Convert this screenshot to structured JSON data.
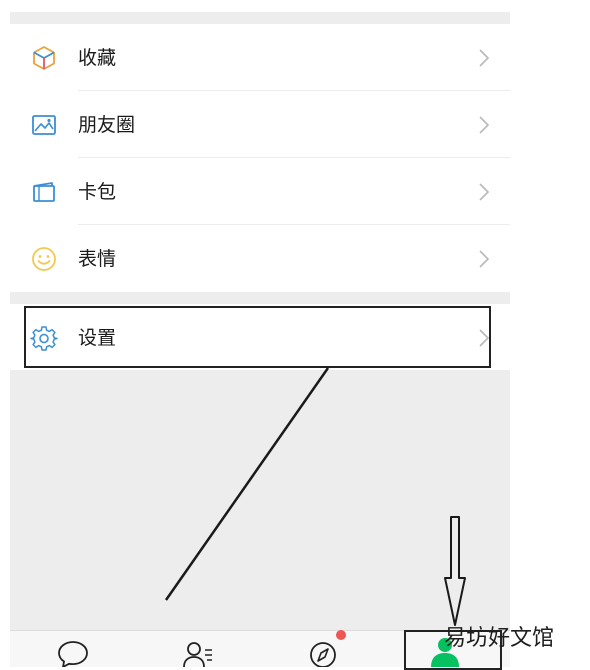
{
  "menu": {
    "items": [
      {
        "label": "收藏",
        "icon": "favorites-cube-icon"
      },
      {
        "label": "朋友圈",
        "icon": "moments-photo-icon"
      },
      {
        "label": "卡包",
        "icon": "card-wallet-icon"
      },
      {
        "label": "表情",
        "icon": "sticker-smiley-icon"
      }
    ],
    "settings": {
      "label": "设置",
      "icon": "gear-icon"
    }
  },
  "tabbar": {
    "tabs": [
      {
        "name": "chats",
        "icon": "chat-bubble-icon"
      },
      {
        "name": "contacts",
        "icon": "contacts-icon"
      },
      {
        "name": "discover",
        "icon": "compass-icon",
        "badge": true
      },
      {
        "name": "me",
        "icon": "me-person-icon",
        "active": true
      }
    ]
  },
  "watermark": {
    "text": "易坊好文馆"
  },
  "colors": {
    "accent": "#07c160",
    "badge": "#f05454",
    "favorites": "#e9a23b",
    "moments": "#3b8fd4",
    "card": "#3b8fd4",
    "sticker": "#f2c94c",
    "settings": "#3b8fd4"
  }
}
